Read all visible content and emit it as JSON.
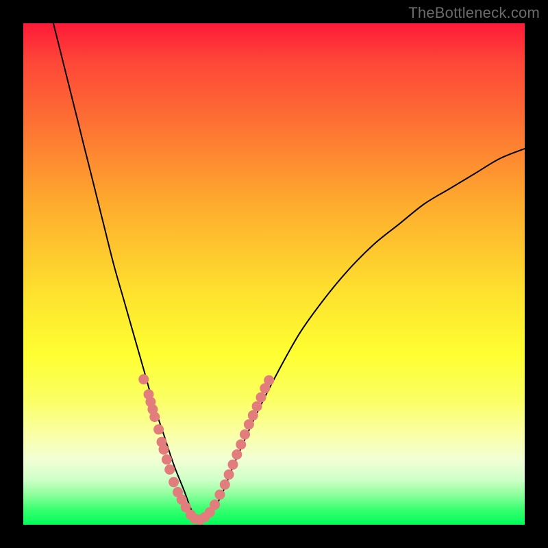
{
  "watermark": "TheBottleneck.com",
  "colors": {
    "background": "#000000",
    "curve_stroke": "#000000",
    "marker_fill": "#e37c7c",
    "gradient_top": "#fe1a38",
    "gradient_bottom": "#00fe5a"
  },
  "chart_data": {
    "type": "line",
    "title": "",
    "xlabel": "",
    "ylabel": "",
    "xlim": [
      0,
      100
    ],
    "ylim": [
      0,
      100
    ],
    "curve": {
      "description": "V-shaped bottleneck curve, vertex near x≈34, y≈0",
      "x": [
        6,
        8,
        10,
        12,
        14,
        16,
        18,
        20,
        22,
        24,
        26,
        28,
        30,
        32,
        34,
        36,
        38,
        40,
        42,
        46,
        50,
        55,
        60,
        65,
        70,
        75,
        80,
        85,
        90,
        95,
        100
      ],
      "y": [
        100,
        92,
        84,
        76,
        68,
        60,
        52,
        45,
        38,
        31,
        24,
        18,
        12,
        7,
        2,
        1,
        3,
        7,
        12,
        21,
        29,
        38,
        45,
        51,
        56,
        60,
        64,
        67,
        70,
        73,
        75
      ]
    },
    "markers": {
      "description": "Salmon dots clustered along the lower V segments",
      "points": [
        {
          "x": 24.0,
          "y": 29.0
        },
        {
          "x": 25.0,
          "y": 26.0
        },
        {
          "x": 25.4,
          "y": 24.5
        },
        {
          "x": 25.8,
          "y": 23.0
        },
        {
          "x": 26.2,
          "y": 21.5
        },
        {
          "x": 27.0,
          "y": 19.0
        },
        {
          "x": 27.6,
          "y": 16.5
        },
        {
          "x": 28.0,
          "y": 15.0
        },
        {
          "x": 28.6,
          "y": 13.0
        },
        {
          "x": 29.2,
          "y": 11.0
        },
        {
          "x": 30.0,
          "y": 8.5
        },
        {
          "x": 30.8,
          "y": 6.5
        },
        {
          "x": 31.6,
          "y": 5.0
        },
        {
          "x": 32.4,
          "y": 3.5
        },
        {
          "x": 33.4,
          "y": 2.0
        },
        {
          "x": 34.2,
          "y": 1.2
        },
        {
          "x": 35.2,
          "y": 1.0
        },
        {
          "x": 36.2,
          "y": 1.5
        },
        {
          "x": 37.2,
          "y": 2.5
        },
        {
          "x": 38.2,
          "y": 4.0
        },
        {
          "x": 39.2,
          "y": 6.0
        },
        {
          "x": 40.2,
          "y": 8.0
        },
        {
          "x": 41.0,
          "y": 10.0
        },
        {
          "x": 41.8,
          "y": 12.0
        },
        {
          "x": 42.6,
          "y": 14.0
        },
        {
          "x": 43.4,
          "y": 16.0
        },
        {
          "x": 44.2,
          "y": 18.0
        },
        {
          "x": 45.0,
          "y": 20.0
        },
        {
          "x": 45.8,
          "y": 21.8
        },
        {
          "x": 46.6,
          "y": 23.6
        },
        {
          "x": 47.4,
          "y": 25.4
        },
        {
          "x": 48.2,
          "y": 27.2
        },
        {
          "x": 49.0,
          "y": 28.8
        }
      ]
    }
  }
}
